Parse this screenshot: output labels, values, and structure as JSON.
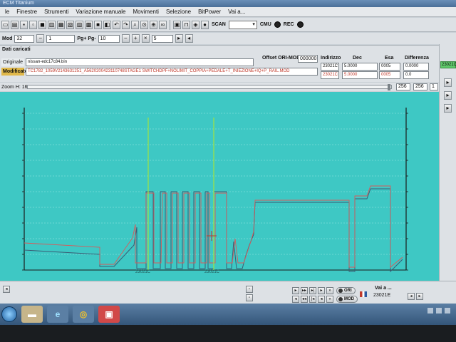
{
  "window": {
    "title": "ECM Titanium"
  },
  "menu": [
    "le",
    "Finestre",
    "Strumenti",
    "Variazione manuale",
    "Movimenti",
    "Selezione",
    "BitPower",
    "Vai a..."
  ],
  "toolbar": {
    "scan_label": "SCAN",
    "select_value": "",
    "cmu_label": "CMU",
    "rec_label": "REC"
  },
  "toolbar2": {
    "mod_label": "Mod",
    "mod_value": "32",
    "step_value": "1",
    "pg_label": "Pg+ Pg-",
    "pg_value": "10",
    "n_value": "5"
  },
  "files": {
    "section_title": "Dati caricati",
    "original_label": "Originale",
    "original_value": "nissan-edc17c84.bin",
    "modified_label": "Modificato",
    "modified_value": "TC1782_1059V2143631251_A5620200423110748STAGE1 SWITCHDPF+NOLIMIT_COPPIA+PEDALE+T_INIEZIONE+IQ+P_RAIL.MOD",
    "offset_label": "Offset ORI-MOD",
    "offset_value": "000000",
    "headers": {
      "indirizzo": "Indirizzo",
      "dec": "Dec",
      "esa": "Esa",
      "diff": "Differenza"
    },
    "row1": {
      "indirizzo": "23021C",
      "dec": "5.0000",
      "esa": "0005",
      "diff": "0.0000"
    },
    "row2": {
      "indirizzo": "23021C",
      "dec": "5.0000",
      "esa": "0005",
      "diff": "0.0"
    }
  },
  "zoom": {
    "label": "Zoom H: 16",
    "value_a": "256",
    "value_b": "256",
    "value_c": "1"
  },
  "graph": {
    "cursor_label_1": "23021C",
    "cursor_label_2": "23021C"
  },
  "right_panel": {
    "green_value": "23021C"
  },
  "bottom": {
    "ori_label": "ORI",
    "mod_label": "MOD",
    "vai_label": "Vai a ...",
    "vai_value": "23021E"
  },
  "colors": {
    "graph_bg": "#3ec8c4",
    "original_line": "#2a3a8a",
    "modified_line": "#d85a5a",
    "cursor_line": "#9be04a",
    "accent_red": "#c0392b"
  },
  "chart_data": {
    "type": "line",
    "title": "",
    "xlabel": "",
    "ylabel": "",
    "series": [
      {
        "values": [
          5,
          5,
          5,
          5,
          5,
          5,
          5,
          5,
          5,
          5,
          5,
          5,
          5,
          5,
          5,
          5,
          5,
          5,
          5,
          5,
          5,
          5
        ]
      },
      {
        "values": [
          3,
          3,
          3,
          3,
          3,
          3,
          3,
          3,
          9,
          9,
          9,
          9,
          9,
          9,
          9,
          9,
          9,
          9,
          9,
          9,
          5,
          5
        ]
      }
    ]
  }
}
